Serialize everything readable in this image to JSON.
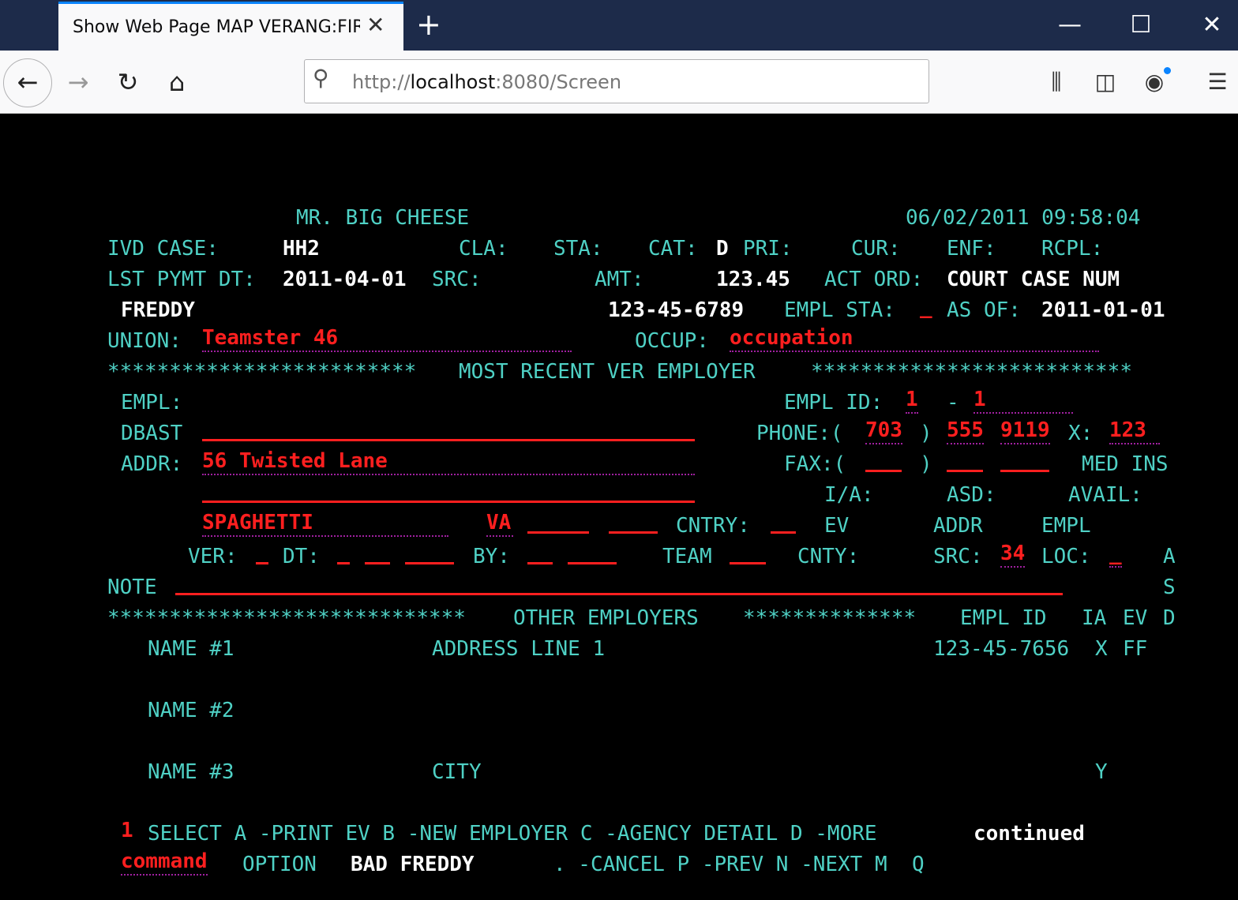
{
  "browser": {
    "tab_title": "Show Web Page MAP VERANG:FIRST",
    "tab_close": "✕",
    "new_tab": "+",
    "win_minimize": "—",
    "win_maximize": "☐",
    "win_close": "✕",
    "back": "←",
    "forward": "→",
    "reload": "↻",
    "home": "⌂",
    "search_glyph": "⚲",
    "url_scheme": "http://",
    "url_host": "localhost",
    "url_path": ":8080/Screen",
    "library": "⫼",
    "sidebar": "◫",
    "account": "◉",
    "menu": "☰"
  },
  "screen": {
    "header_name": "MR. BIG CHEESE",
    "header_datetime": "06/02/2011 09:58:04",
    "ivd_case_label": "IVD CASE:",
    "ivd_case_value": "HH2",
    "cla_label": "CLA:",
    "sta_label": "STA:",
    "cat_label": "CAT:",
    "cat_value": "D",
    "pri_label": "PRI:",
    "cur_label": "CUR:",
    "enf_label": "ENF:",
    "rcpl_label": "RCPL:",
    "lst_pymt_label": "LST PYMT DT:",
    "lst_pymt_value": "2011-04-01",
    "src_label": "SRC:",
    "amt_label": "AMT:",
    "amt_value": "123.45",
    "act_ord_label": "ACT ORD:",
    "act_ord_value": "COURT CASE NUM",
    "person_name": "FREDDY",
    "ssn": "123-45-6789",
    "empl_sta_label": "EMPL STA:",
    "empl_sta_value": "_",
    "as_of_label": "AS OF:",
    "as_of_value": "2011-01-01",
    "union_label": "UNION:",
    "union_value": "Teamster 46",
    "occup_label": "OCCUP:",
    "occup_value": "occupation",
    "section1_stars_left": "*************************",
    "section1_title": "MOST RECENT VER EMPLOYER",
    "section1_stars_right": "**************************",
    "empl_label": "EMPL:",
    "empl_id_label": "EMPL ID:",
    "empl_id_1": "1",
    "empl_id_dash": "-",
    "empl_id_2": "1",
    "dbast_label": "DBAST",
    "phone_label": "PHONE:(",
    "phone_area": "703",
    "phone_close": ")",
    "phone_prefix": "555",
    "phone_line": "9119",
    "phone_ext_label": "X:",
    "phone_ext": "123",
    "addr_label": "ADDR:",
    "addr_value": "56 Twisted Lane",
    "fax_label": "FAX:(",
    "fax_close": ")",
    "med_ins_label": "MED INS",
    "ia_label": "I/A:",
    "asd_label": "ASD:",
    "avail_label": "AVAIL:",
    "city_value": "SPAGHETTI",
    "state_value": "VA",
    "cntry_label": "CNTRY:",
    "ev_label": "EV",
    "addr2_label": "ADDR",
    "empl2_label": "EMPL",
    "ver_label": "VER:",
    "dt_label": "DT:",
    "by_label": "BY:",
    "team_label": "TEAM",
    "cnty_label": "CNTY:",
    "src2_label": "SRC:",
    "src2_value": "34",
    "loc_label": "LOC:",
    "loc_value": "_",
    "col_a": "A",
    "note_label": "NOTE",
    "col_s": "S",
    "section2_stars_left": "*****************************",
    "section2_title": "OTHER EMPLOYERS",
    "section2_stars_right": "**************",
    "empl_id_col": "EMPL ID",
    "ia_col": "IA",
    "ev_col": "EV",
    "d_col": "D",
    "name1": "NAME #1",
    "address_line1": "ADDRESS LINE 1",
    "other_empl_id": "123-45-7656",
    "other_ia": "X",
    "other_ev": "FF",
    "name2": "NAME #2",
    "name3": "NAME #3",
    "city_label": "CITY",
    "other_y": "Y",
    "select_value": "1",
    "select_text": "SELECT A -PRINT EV B -NEW EMPLOYER C -AGENCY DETAIL D -MORE",
    "continued": "continued",
    "command_value": "command",
    "option_label": "OPTION",
    "option_value": "BAD FREDDY",
    "option_text": ". -CANCEL P -PREV N -NEXT M  Q"
  }
}
